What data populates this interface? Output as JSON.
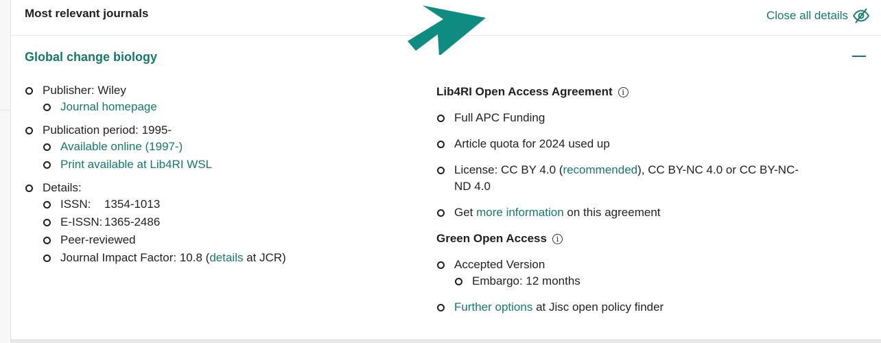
{
  "header": {
    "section_title": "Most relevant journals",
    "close_all_label": "Close all details"
  },
  "journal": {
    "title": "Global change biology",
    "publisher_label": "Publisher: Wiley",
    "homepage_link": "Journal homepage",
    "publication_period": "Publication period: 1995-",
    "available_online": "Available online (1997-)",
    "print_available": "Print available at Lib4RI WSL",
    "details_label": "Details:",
    "issn_key": "ISSN:",
    "issn_value": "1354-1013",
    "eissn_key": "E-ISSN:",
    "eissn_value": "1365-2486",
    "peer_reviewed": "Peer-reviewed",
    "jif_prefix": "Journal Impact Factor: 10.8 (",
    "jif_link": "details",
    "jif_suffix": " at JCR)"
  },
  "agreement": {
    "heading": "Lib4RI Open Access Agreement",
    "item_funding": "Full APC Funding",
    "item_quota": "Article quota for 2024 used up",
    "license_prefix": "License: CC BY 4.0 (",
    "license_link": "recommended",
    "license_suffix": "), CC BY-NC 4.0 or CC BY-NC-ND 4.0",
    "get_prefix": "Get ",
    "get_link": "more information",
    "get_suffix": " on this agreement"
  },
  "green": {
    "heading": "Green Open Access",
    "accepted_version": "Accepted Version",
    "embargo": "Embargo: 12 months",
    "further_link": "Further options",
    "further_suffix": " at Jisc open policy finder"
  },
  "colors": {
    "accent": "#137a6d",
    "arrow": "#0e8c82"
  },
  "icons": {
    "close_all": "eye-slash-icon",
    "collapse": "minus-icon",
    "info": "info-icon",
    "bullet": "circle-bullet-icon",
    "pointer": "arrow-pointer-icon"
  }
}
